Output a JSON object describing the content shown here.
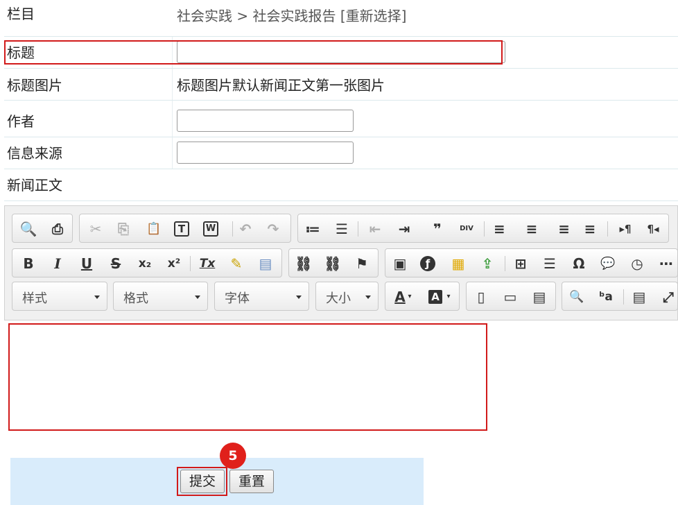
{
  "form": {
    "column_label": "栏目",
    "breadcrumb": "社会实践 > 社会实践报告 [重新选择]",
    "title_label": "标题",
    "title_value": "",
    "title_image_label": "标题图片",
    "title_image_note": "标题图片默认新闻正文第一张图片",
    "author_label": "作者",
    "author_value": "",
    "source_label": "信息来源",
    "source_value": "",
    "body_label": "新闻正文"
  },
  "editor": {
    "combos": {
      "styles": "样式",
      "format": "格式",
      "font": "字体",
      "size": "大小"
    },
    "icons": {
      "preview": "🔍",
      "print": "⎙",
      "cut": "✂",
      "copy": "⎘",
      "paste": "📋",
      "paste_text": "T",
      "paste_word": "W",
      "undo": "↶",
      "redo": "↷",
      "ordered_list": "≔",
      "bulleted_list": "☰",
      "outdent": "⇤",
      "indent": "⇥",
      "blockquote": "❞",
      "div": "DIV",
      "align_left": "≡",
      "align_center": "≡",
      "align_right": "≡",
      "justify": "≡",
      "ltr": "▸¶",
      "rtl": "¶◂",
      "bold": "B",
      "italic": "I",
      "underline": "U",
      "strike": "S",
      "subscript": "x₂",
      "superscript": "x²",
      "remove_format": "Tx",
      "spell": "✎",
      "templates": "▤",
      "link": "⛓",
      "unlink": "⛓",
      "anchor": "⚑",
      "image": "▣",
      "flash": "ƒ",
      "media": "▦",
      "upload": "⇪",
      "table": "⊞",
      "hr": "☰",
      "special_char": "Ω",
      "smiley": "💬",
      "clock": "◷",
      "pagebreak": "⋯",
      "text_color": "A",
      "bg_color": "A",
      "show_blocks": "▯",
      "new_page": "▭",
      "source_doc": "▤",
      "find": "🔍",
      "replace": "ᵇa",
      "show_border": "▤",
      "maximize": "⤢"
    }
  },
  "actions": {
    "submit_label": "提交",
    "reset_label": "重置",
    "step_number": "5"
  }
}
